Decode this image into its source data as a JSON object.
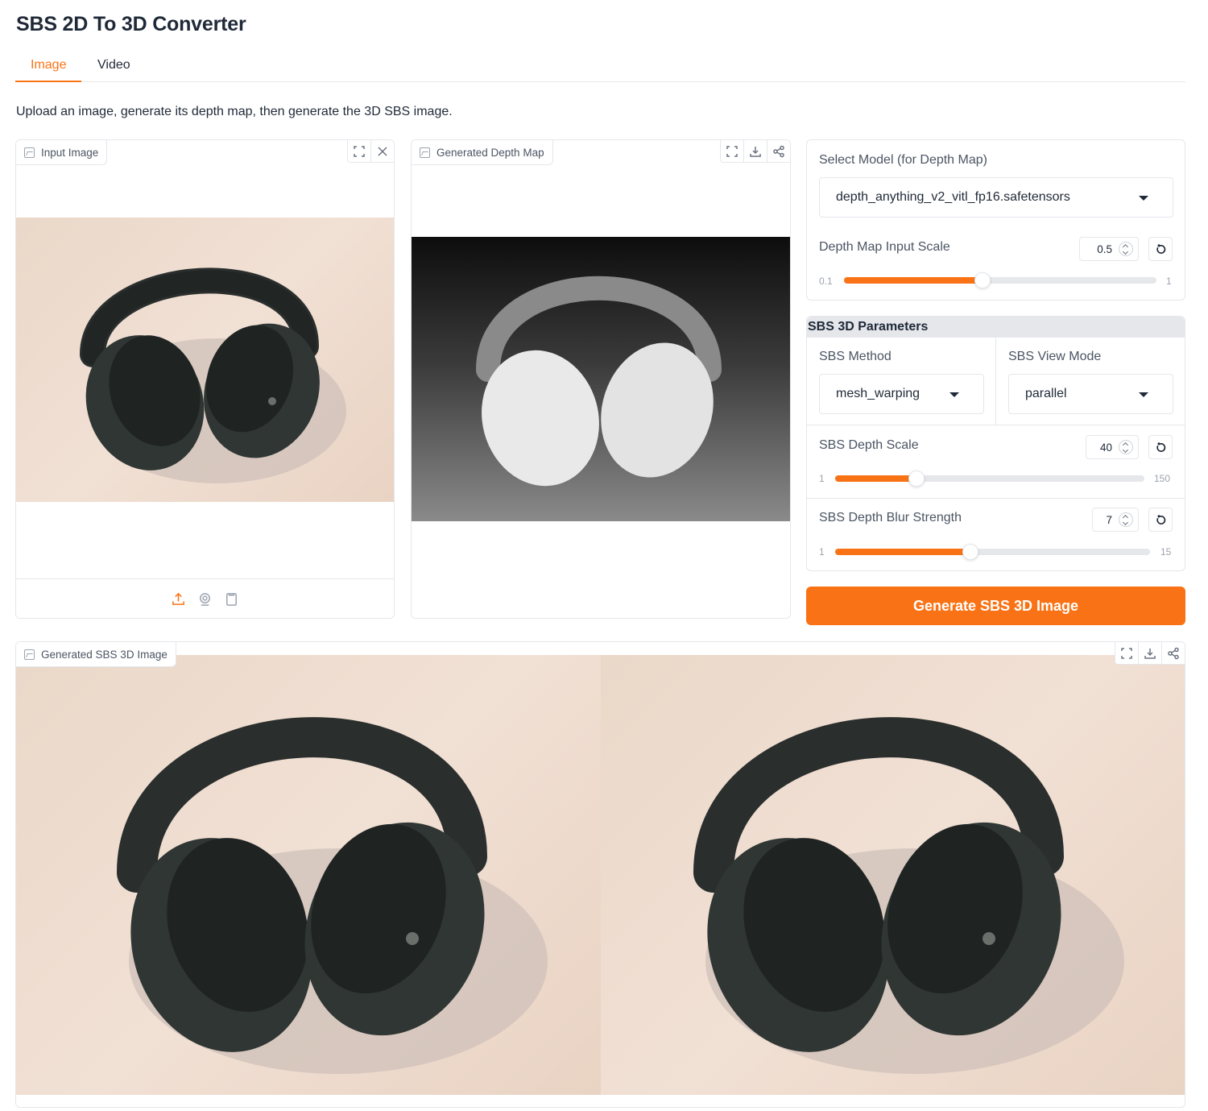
{
  "app": {
    "title": "SBS 2D To 3D Converter",
    "description": "Upload an image, generate its depth map, then generate the 3D SBS image."
  },
  "tabs": [
    {
      "label": "Image",
      "active": true
    },
    {
      "label": "Video",
      "active": false
    }
  ],
  "input_image": {
    "label": "Input Image",
    "tools": [
      "fullscreen-icon",
      "close-icon"
    ],
    "upload_sources": [
      "upload-icon",
      "webcam-icon",
      "clipboard-icon"
    ]
  },
  "depth_map": {
    "label": "Generated Depth Map",
    "tools": [
      "fullscreen-icon",
      "download-icon",
      "share-icon"
    ]
  },
  "model": {
    "label": "Select Model (for Depth Map)",
    "value": "depth_anything_v2_vitl_fp16.safetensors",
    "input_scale": {
      "label": "Depth Map Input Scale",
      "value": "0.5",
      "min": "0.1",
      "max": "1",
      "fraction": 0.444
    }
  },
  "sbs_params": {
    "heading": "SBS 3D Parameters",
    "method": {
      "label": "SBS Method",
      "value": "mesh_warping"
    },
    "view_mode": {
      "label": "SBS View Mode",
      "value": "parallel"
    },
    "depth_scale": {
      "label": "SBS Depth Scale",
      "value": "40",
      "min": "1",
      "max": "150",
      "fraction": 0.262
    },
    "blur_strength": {
      "label": "SBS Depth Blur Strength",
      "value": "7",
      "min": "1",
      "max": "15",
      "fraction": 0.429
    }
  },
  "generate_button": {
    "label": "Generate SBS 3D Image"
  },
  "sbs_output": {
    "label": "Generated SBS 3D Image",
    "tools": [
      "fullscreen-icon",
      "download-icon",
      "share-icon"
    ]
  },
  "colors": {
    "accent": "#f97316",
    "border": "#e5e7eb",
    "text": "#1f2937",
    "muted": "#4b5563"
  }
}
